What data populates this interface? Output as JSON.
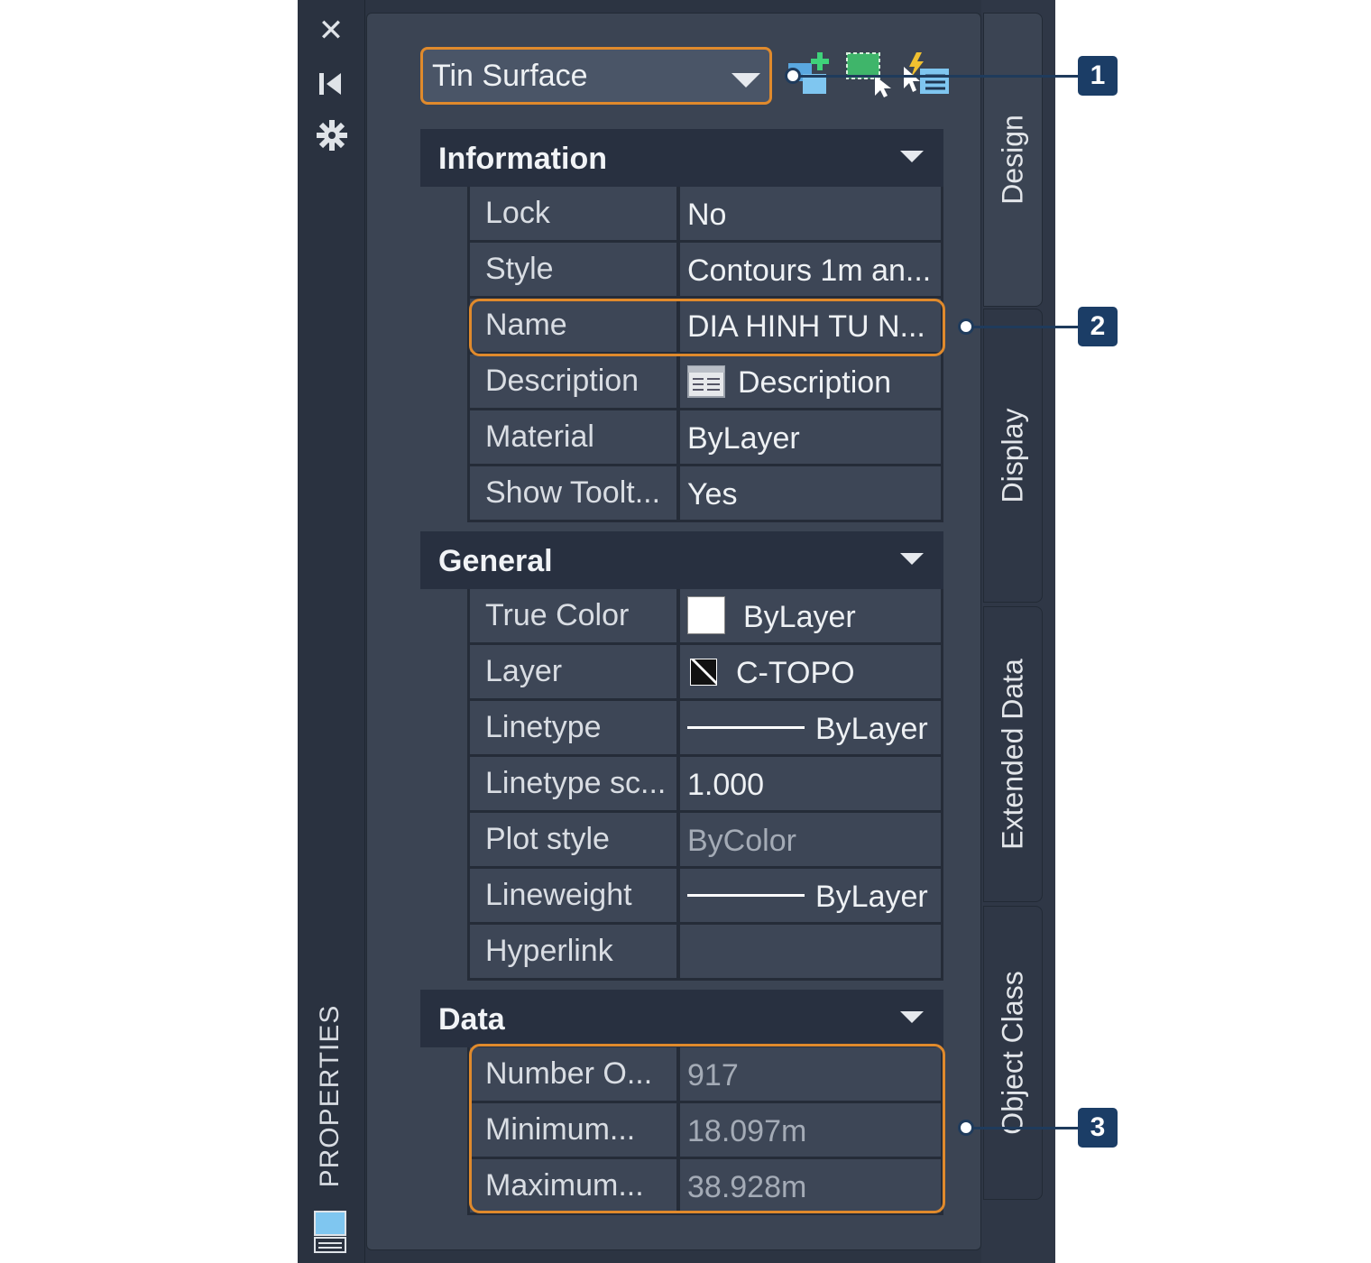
{
  "palette": {
    "title": "PROPERTIES"
  },
  "selector": {
    "value": "Tin Surface"
  },
  "toolbar": {
    "icons": [
      "add-to-selection-icon",
      "select-objects-icon",
      "quick-select-icon"
    ]
  },
  "tabs": {
    "design": "Design",
    "display": "Display",
    "extended": "Extended Data",
    "object_class": "Object Class"
  },
  "sections": {
    "information": {
      "title": "Information",
      "rows": [
        {
          "label": "Lock",
          "value": "No"
        },
        {
          "label": "Style",
          "value": "Contours 1m an..."
        },
        {
          "label": "Name",
          "value": "DIA HINH TU N..."
        },
        {
          "label": "Description",
          "value": "Description"
        },
        {
          "label": "Material",
          "value": "ByLayer"
        },
        {
          "label": "Show Toolt...",
          "value": "Yes"
        }
      ]
    },
    "general": {
      "title": "General",
      "rows": [
        {
          "label": "True Color",
          "value": "ByLayer"
        },
        {
          "label": "Layer",
          "value": "C-TOPO"
        },
        {
          "label": "Linetype",
          "value": "ByLayer"
        },
        {
          "label": "Linetype  sc...",
          "value": "1.000"
        },
        {
          "label": "Plot style",
          "value": "ByColor"
        },
        {
          "label": "Lineweight",
          "value": "ByLayer"
        },
        {
          "label": "Hyperlink",
          "value": ""
        }
      ]
    },
    "data": {
      "title": "Data",
      "rows": [
        {
          "label": "Number O...",
          "value": "917"
        },
        {
          "label": "Minimum...",
          "value": "18.097m"
        },
        {
          "label": "Maximum...",
          "value": "38.928m"
        }
      ]
    }
  },
  "callouts": [
    "1",
    "2",
    "3"
  ],
  "colors": {
    "highlight": "#e08a2c",
    "badge": "#1b3d66"
  }
}
